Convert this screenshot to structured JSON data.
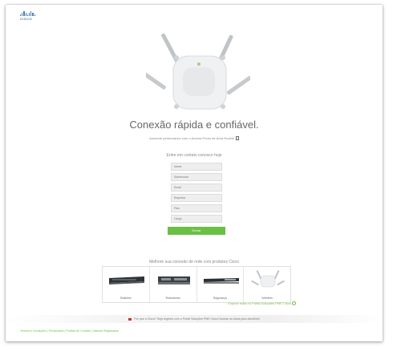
{
  "brand": {
    "logo_text": "CISCO"
  },
  "hero": {
    "title": "Conexão rápida e confiável.",
    "subtitle": "Aumente performance com o Access Ponto de Área Rodeie"
  },
  "form": {
    "heading": "Entre em contato conosco hoje",
    "fields": [
      {
        "placeholder": "Nome"
      },
      {
        "placeholder": "Sobrenome"
      },
      {
        "placeholder": "Email"
      },
      {
        "placeholder": "Empresa"
      },
      {
        "placeholder": "País"
      },
      {
        "placeholder": "Cargo"
      }
    ],
    "submit_label": "Enviar"
  },
  "products": {
    "heading": "Melhore sua conexão de rede com produtos Cisco",
    "items": [
      {
        "label": "Switches",
        "icon": "switch-icon"
      },
      {
        "label": "Roteadores",
        "icon": "router-icon"
      },
      {
        "label": "Segurança",
        "icon": "security-appliance-icon"
      },
      {
        "label": "Wireless",
        "icon": "access-point-icon"
      }
    ],
    "explore_link": "Explore mais no Portal Soluções PME Cisco"
  },
  "banner": {
    "text": "Por que a Cisco? Seja registro com o Portal Soluções PME Cisco! Acesse as dicas para decolhiek"
  },
  "footer": {
    "links": "Termos e Condições | Privacidade | Política de Cookies | Marcas Registradas"
  },
  "colors": {
    "accent": "#6bbf45",
    "brand": "#4a7db3"
  }
}
